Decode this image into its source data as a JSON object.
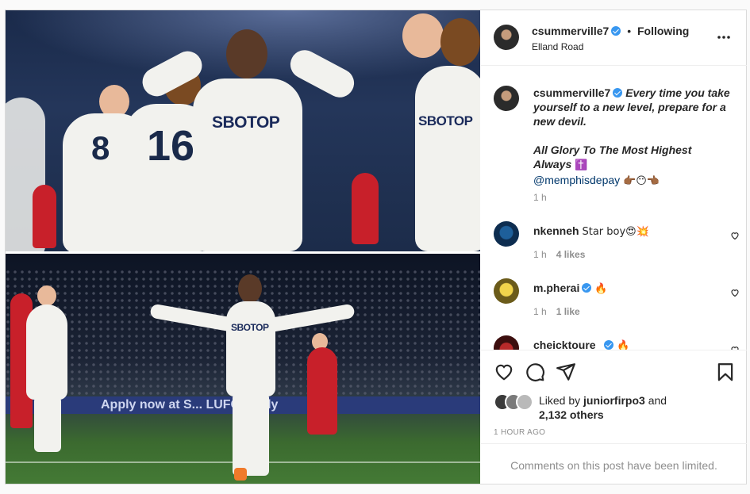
{
  "post": {
    "author": {
      "username": "csummerville7",
      "separator": "•",
      "follow_status": "Following",
      "location": "Elland Road"
    },
    "more_icon": "more-horizontal-icon",
    "photos": {
      "top": {
        "sponsor": "SBOTOP",
        "numbers": [
          "8",
          "16"
        ],
        "side_sponsor": "SBOTOP"
      },
      "bottom": {
        "sponsor": "SBOTOP",
        "ad_board": "Apply now at S...   LUFC          Apply"
      }
    },
    "caption": {
      "username": "csummerville7",
      "line1": "Every time you take yourself to a new level, prepare for a new devil.",
      "line2": "All Glory To The Most Highest Always",
      "line2_emoji": "✝️",
      "mention": "@memphisdepay",
      "mention_emoji": "👉🏾😶👈🏾",
      "time": "1 h"
    },
    "comments": [
      {
        "username": "nkenneh",
        "verified": false,
        "text": "Star boy😍💥",
        "time": "1 h",
        "likes": "4 likes"
      },
      {
        "username": "m.pherai",
        "verified": true,
        "text": "🔥",
        "time": "1 h",
        "likes": "1 like"
      },
      {
        "username": "cheicktoure_",
        "verified": true,
        "text": "🔥",
        "time": "",
        "likes": ""
      }
    ],
    "actions": {
      "like_icon": "heart-icon",
      "comment_icon": "comment-icon",
      "share_icon": "send-icon",
      "save_icon": "bookmark-icon"
    },
    "liked_by": {
      "prefix": "Liked by",
      "username": "juniorfirpo3",
      "and": "and",
      "others": "2,132 others"
    },
    "time_ago": "1 HOUR AGO",
    "comments_limited": "Comments on this post have been limited."
  }
}
